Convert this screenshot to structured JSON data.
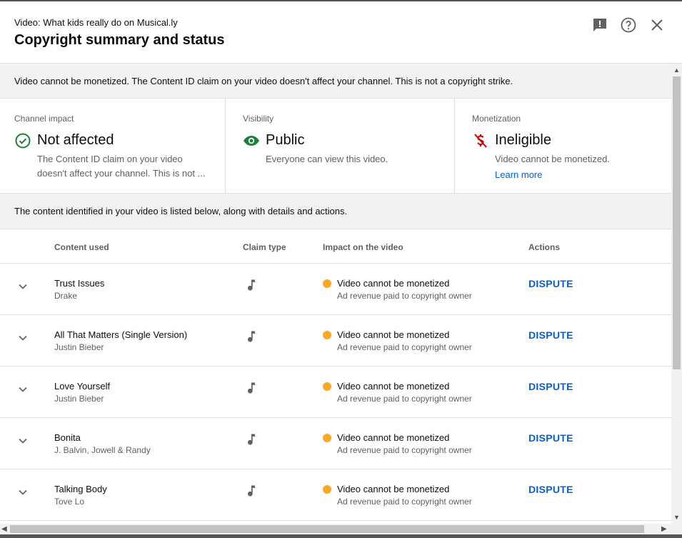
{
  "header": {
    "video_title": "Video: What kids really do on Musical.ly",
    "dialog_title": "Copyright summary and status",
    "icons": [
      "feedback-icon",
      "help-icon",
      "close-icon"
    ]
  },
  "banner": {
    "text": "Video cannot be monetized. The Content ID claim on your video doesn't affect your channel. This is not a copyright strike."
  },
  "cards": {
    "channel_impact": {
      "label": "Channel impact",
      "value": "Not affected",
      "desc_line1": "The Content ID claim on your video",
      "desc_line2": "doesn't affect your channel. This is not ...",
      "icon": "check-circle-icon",
      "color": "#0f9d58"
    },
    "visibility": {
      "label": "Visibility",
      "value": "Public",
      "desc": "Everyone can view this video.",
      "icon": "eye-icon",
      "color": "#188038"
    },
    "monetization": {
      "label": "Monetization",
      "value": "Ineligible",
      "desc": "Video cannot be monetized.",
      "link": "Learn more",
      "icon": "no-dollar-icon",
      "color": "#cc0000"
    }
  },
  "info_bar": {
    "text": "The content identified in your video is listed below, along with details and actions."
  },
  "table": {
    "columns": {
      "content": "Content used",
      "claim": "Claim type",
      "impact": "Impact on the video",
      "actions": "Actions"
    },
    "rows": [
      {
        "song": "Trust Issues",
        "artist": "Drake",
        "impact": "Video cannot be monetized",
        "impact_sub": "Ad revenue paid to copyright owner",
        "action": "DISPUTE"
      },
      {
        "song": "All That Matters (Single Version)",
        "artist": "Justin Bieber",
        "impact": "Video cannot be monetized",
        "impact_sub": "Ad revenue paid to copyright owner",
        "action": "DISPUTE"
      },
      {
        "song": "Love Yourself",
        "artist": "Justin Bieber",
        "impact": "Video cannot be monetized",
        "impact_sub": "Ad revenue paid to copyright owner",
        "action": "DISPUTE"
      },
      {
        "song": "Bonita",
        "artist": "J. Balvin, Jowell & Randy",
        "impact": "Video cannot be monetized",
        "impact_sub": "Ad revenue paid to copyright owner",
        "action": "DISPUTE"
      },
      {
        "song": "Talking Body",
        "artist": "Tove Lo",
        "impact": "Video cannot be monetized",
        "impact_sub": "Ad revenue paid to copyright owner",
        "action": "DISPUTE"
      }
    ],
    "status_color": "#f9a825",
    "link_color": "#065fd4"
  }
}
